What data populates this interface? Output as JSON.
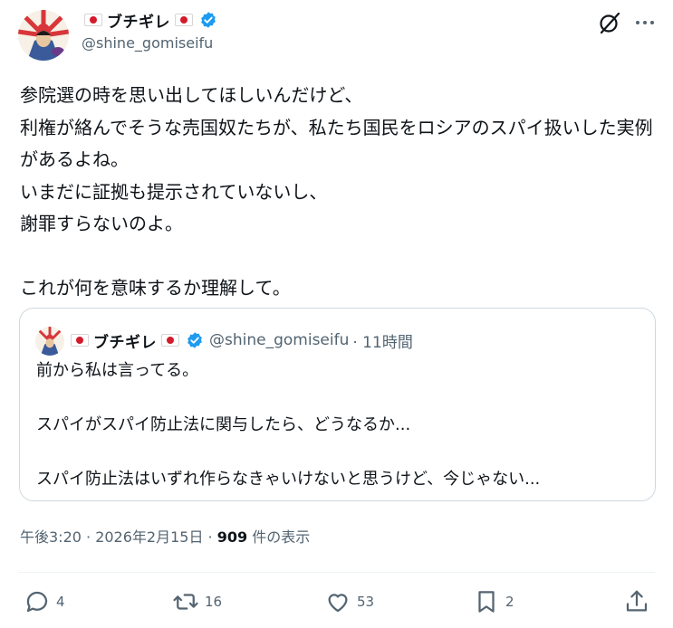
{
  "author": {
    "name": "ブチギレ",
    "handle": "@shine_gomiseifu",
    "verified": true
  },
  "post": {
    "text": "参院選の時を思い出してほしいんだけど、\n利権が絡んでそうな売国奴たちが、私たち国民をロシアのスパイ扱いした実例があるよね。\nいまだに証拠も提示されていないし、\n謝罪すらないのよ。\n\nこれが何を意味するか理解して。"
  },
  "quoted_post": {
    "name": "ブチギレ",
    "handle": "@shine_gomiseifu",
    "time": "· 11時間",
    "text": "前から私は言ってる。\n\nスパイがスパイ防止法に関与したら、どうなるか...\n\nスパイ防止法はいずれ作らなきゃいけないと思うけど、今じゃない..."
  },
  "meta": {
    "timestamp": "午後3:20 · 2026年2月15日 · ",
    "views_count": "909",
    "views_label": " 件の表示"
  },
  "actions": {
    "replies": "4",
    "reposts": "16",
    "likes": "53",
    "bookmarks": "2"
  },
  "icons": {
    "top": [
      "grok-icon",
      "more-icon"
    ],
    "actions": [
      "reply-icon",
      "repost-icon",
      "like-icon",
      "bookmark-icon",
      "share-icon"
    ]
  },
  "colors": {
    "text": "#0f1419",
    "secondary": "#536471",
    "verified": "#1d9bf0",
    "flag_red": "#d31b2b",
    "border": "#cfd9de"
  }
}
